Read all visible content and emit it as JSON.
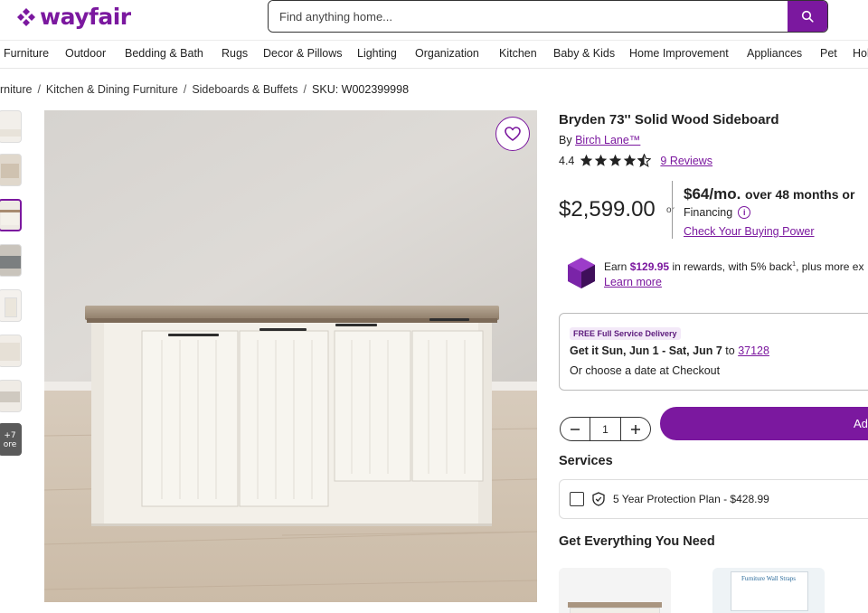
{
  "header": {
    "logo_text": "wayfair",
    "search_placeholder": "Find anything home..."
  },
  "nav": {
    "items": [
      "Furniture",
      "Outdoor",
      "Bedding & Bath",
      "Rugs",
      "Decor & Pillows",
      "Lighting",
      "Organization",
      "Kitchen",
      "Baby & Kids",
      "Home Improvement",
      "Appliances",
      "Pet",
      "Hol"
    ]
  },
  "breadcrumb": {
    "items": [
      "rniture",
      "Kitchen & Dining Furniture",
      "Sideboards & Buffets"
    ],
    "sku": "SKU: W002399998"
  },
  "gallery": {
    "more_label_line1": "+7",
    "more_label_line2": "ore"
  },
  "product": {
    "title": "Bryden 73'' Solid Wood Sideboard",
    "by_label": "By",
    "brand": "Birch Lane™",
    "rating_value": "4.4",
    "rating": 4.4,
    "reviews_label": "9 Reviews",
    "price": "$2,599.00",
    "or_label": "or",
    "monthly": "$64/mo.",
    "monthly_term": "over 48 months or",
    "financing_label": "Financing",
    "buying_power_link": "Check Your Buying Power"
  },
  "rewards": {
    "prefix": "Earn",
    "amount": "$129.95",
    "suffix": "in rewards, with 5% back",
    "sup": "1",
    "tail": ", plus more ex",
    "learn_more": "Learn more"
  },
  "delivery": {
    "badge": "FREE Full Service Delivery",
    "get_it": "Get it Sun, Jun 1 - Sat, Jun 7",
    "to_label": "to",
    "zip": "37128",
    "choose_date": "Or choose a date at Checkout"
  },
  "cart": {
    "quantity": "1",
    "add_label": "Ad"
  },
  "services": {
    "heading": "Services",
    "protection_plan": "5 Year Protection Plan - $428.99"
  },
  "recommendations": {
    "heading": "Get Everything You Need",
    "card2_label": "Furniture Wall Straps"
  },
  "colors": {
    "brand_purple": "#7b189f"
  }
}
